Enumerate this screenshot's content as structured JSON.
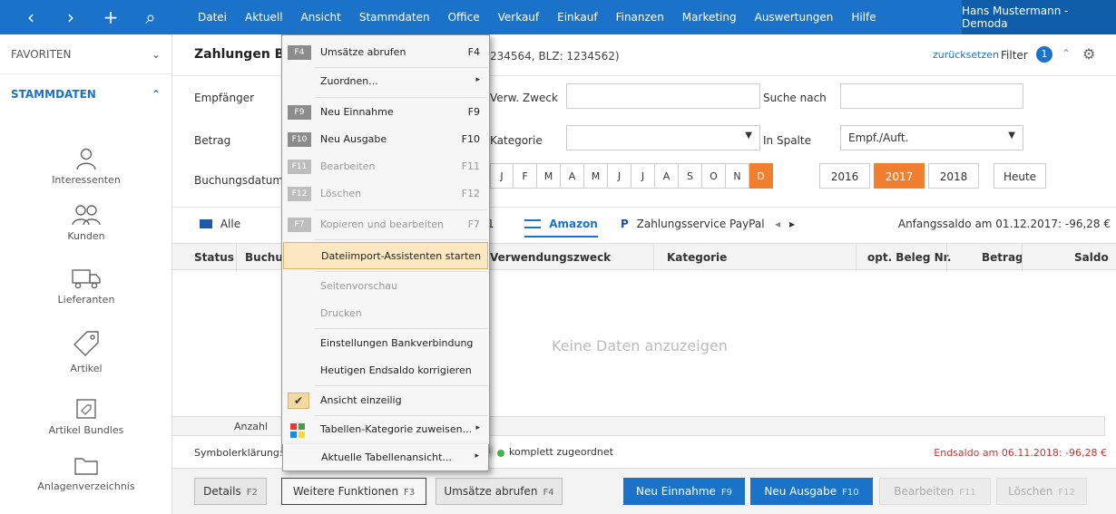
{
  "nav": {
    "back": "‹",
    "forward": "›",
    "add": "+",
    "search_glyph": "⌕"
  },
  "menubar": [
    "Datei",
    "Aktuell",
    "Ansicht",
    "Stammdaten",
    "Office",
    "Verkauf",
    "Einkauf",
    "Finanzen",
    "Marketing",
    "Auswertungen",
    "Hilfe"
  ],
  "user": "Hans Mustermann - Demoda",
  "sidebar": {
    "favoriten": "FAVORITEN",
    "stammdaten": "STAMMDATEN",
    "items": [
      {
        "label": "Interessenten",
        "icon": "person-icon"
      },
      {
        "label": "Kunden",
        "icon": "people-icon"
      },
      {
        "label": "Lieferanten",
        "icon": "truck-icon"
      },
      {
        "label": "Artikel",
        "icon": "tag-icon"
      },
      {
        "label": "Artikel Bundles",
        "icon": "bundle-icon"
      },
      {
        "label": "Anlagenverzeichnis",
        "icon": "folder-icon"
      }
    ]
  },
  "header": {
    "title": "Zahlungen Ba",
    "subtitle": "234564, BLZ: 1234562)",
    "reset": "zurücksetzen",
    "filter": "Filter",
    "filter_count": "1"
  },
  "filters": {
    "empfaenger": "Empfänger",
    "betrag": "Betrag",
    "buchungsdatum": "Buchungsdatum",
    "verw_zweck": "Verw. Zweck",
    "kategorie": "Kategorie",
    "suche_nach": "Suche nach",
    "in_spalte": "In Spalte",
    "in_spalte_value": "Empf./Auft.",
    "months": [
      "J",
      "F",
      "M",
      "A",
      "M",
      "J",
      "J",
      "A",
      "S",
      "O",
      "N",
      "D"
    ],
    "selected_month_index": 11,
    "years": [
      "2016",
      "2017",
      "2018"
    ],
    "selected_year": "2017",
    "heute": "Heute"
  },
  "tabs": {
    "alle": "Alle",
    "partial": "1",
    "amazon": "Amazon",
    "paypal": "Zahlungsservice PayPal",
    "anfangssaldo": "Anfangssaldo am 01.12.2017: -96,28 €"
  },
  "table": {
    "columns": [
      "Status",
      "Buchur",
      "Verwendungszweck",
      "Kategorie",
      "opt. Beleg Nr.",
      "Betrag",
      "Saldo"
    ],
    "empty": "Keine Daten anzuzeigen",
    "count_label": "Anzahl"
  },
  "legend": {
    "label": "Symbolerklärung:",
    "komplett": "komplett zugeordnet",
    "endsaldo": "Endsaldo am 06.11.2018: -96,28 €"
  },
  "buttons": {
    "details": "Details",
    "details_key": "F2",
    "weitere": "Weitere Funktionen",
    "weitere_key": "F3",
    "umsaetze": "Umsätze abrufen",
    "umsaetze_key": "F4",
    "neu_einnahme": "Neu Einnahme",
    "neu_einnahme_key": "F9",
    "neu_ausgabe": "Neu Ausgabe",
    "neu_ausgabe_key": "F10",
    "bearbeiten": "Bearbeiten",
    "bearbeiten_key": "F11",
    "loeschen": "Löschen",
    "loeschen_key": "F12"
  },
  "dropdown": {
    "items": [
      {
        "icon": "F4",
        "label": "Umsätze abrufen",
        "shortcut": "F4"
      },
      {
        "label": "Zuordnen...",
        "submenu": "▸"
      },
      {
        "icon": "F9",
        "label": "Neu Einnahme",
        "shortcut": "F9"
      },
      {
        "icon": "F10",
        "label": "Neu Ausgabe",
        "shortcut": "F10"
      },
      {
        "icon": "F11",
        "label": "Bearbeiten",
        "shortcut": "F11"
      },
      {
        "icon": "F12",
        "label": "Löschen",
        "shortcut": "F12"
      },
      {
        "icon": "F7",
        "label": "Kopieren und bearbeiten",
        "shortcut": "F7"
      },
      {
        "label": "Dateiimport-Assistenten starten"
      },
      {
        "label": "Seitenvorschau"
      },
      {
        "label": "Drucken"
      },
      {
        "label": "Einstellungen Bankverbindung"
      },
      {
        "label": "Heutigen Endsaldo korrigieren"
      },
      {
        "label": "Ansicht einzeilig",
        "check": "✔"
      },
      {
        "label": "Tabellen-Kategorie zuweisen...",
        "submenu": "▸"
      },
      {
        "label": "Aktuelle Tabellenansicht...",
        "submenu": "▸"
      }
    ]
  },
  "colors": {
    "primary": "#1a73c8",
    "accent": "#f08030",
    "danger": "#d32f2f"
  }
}
